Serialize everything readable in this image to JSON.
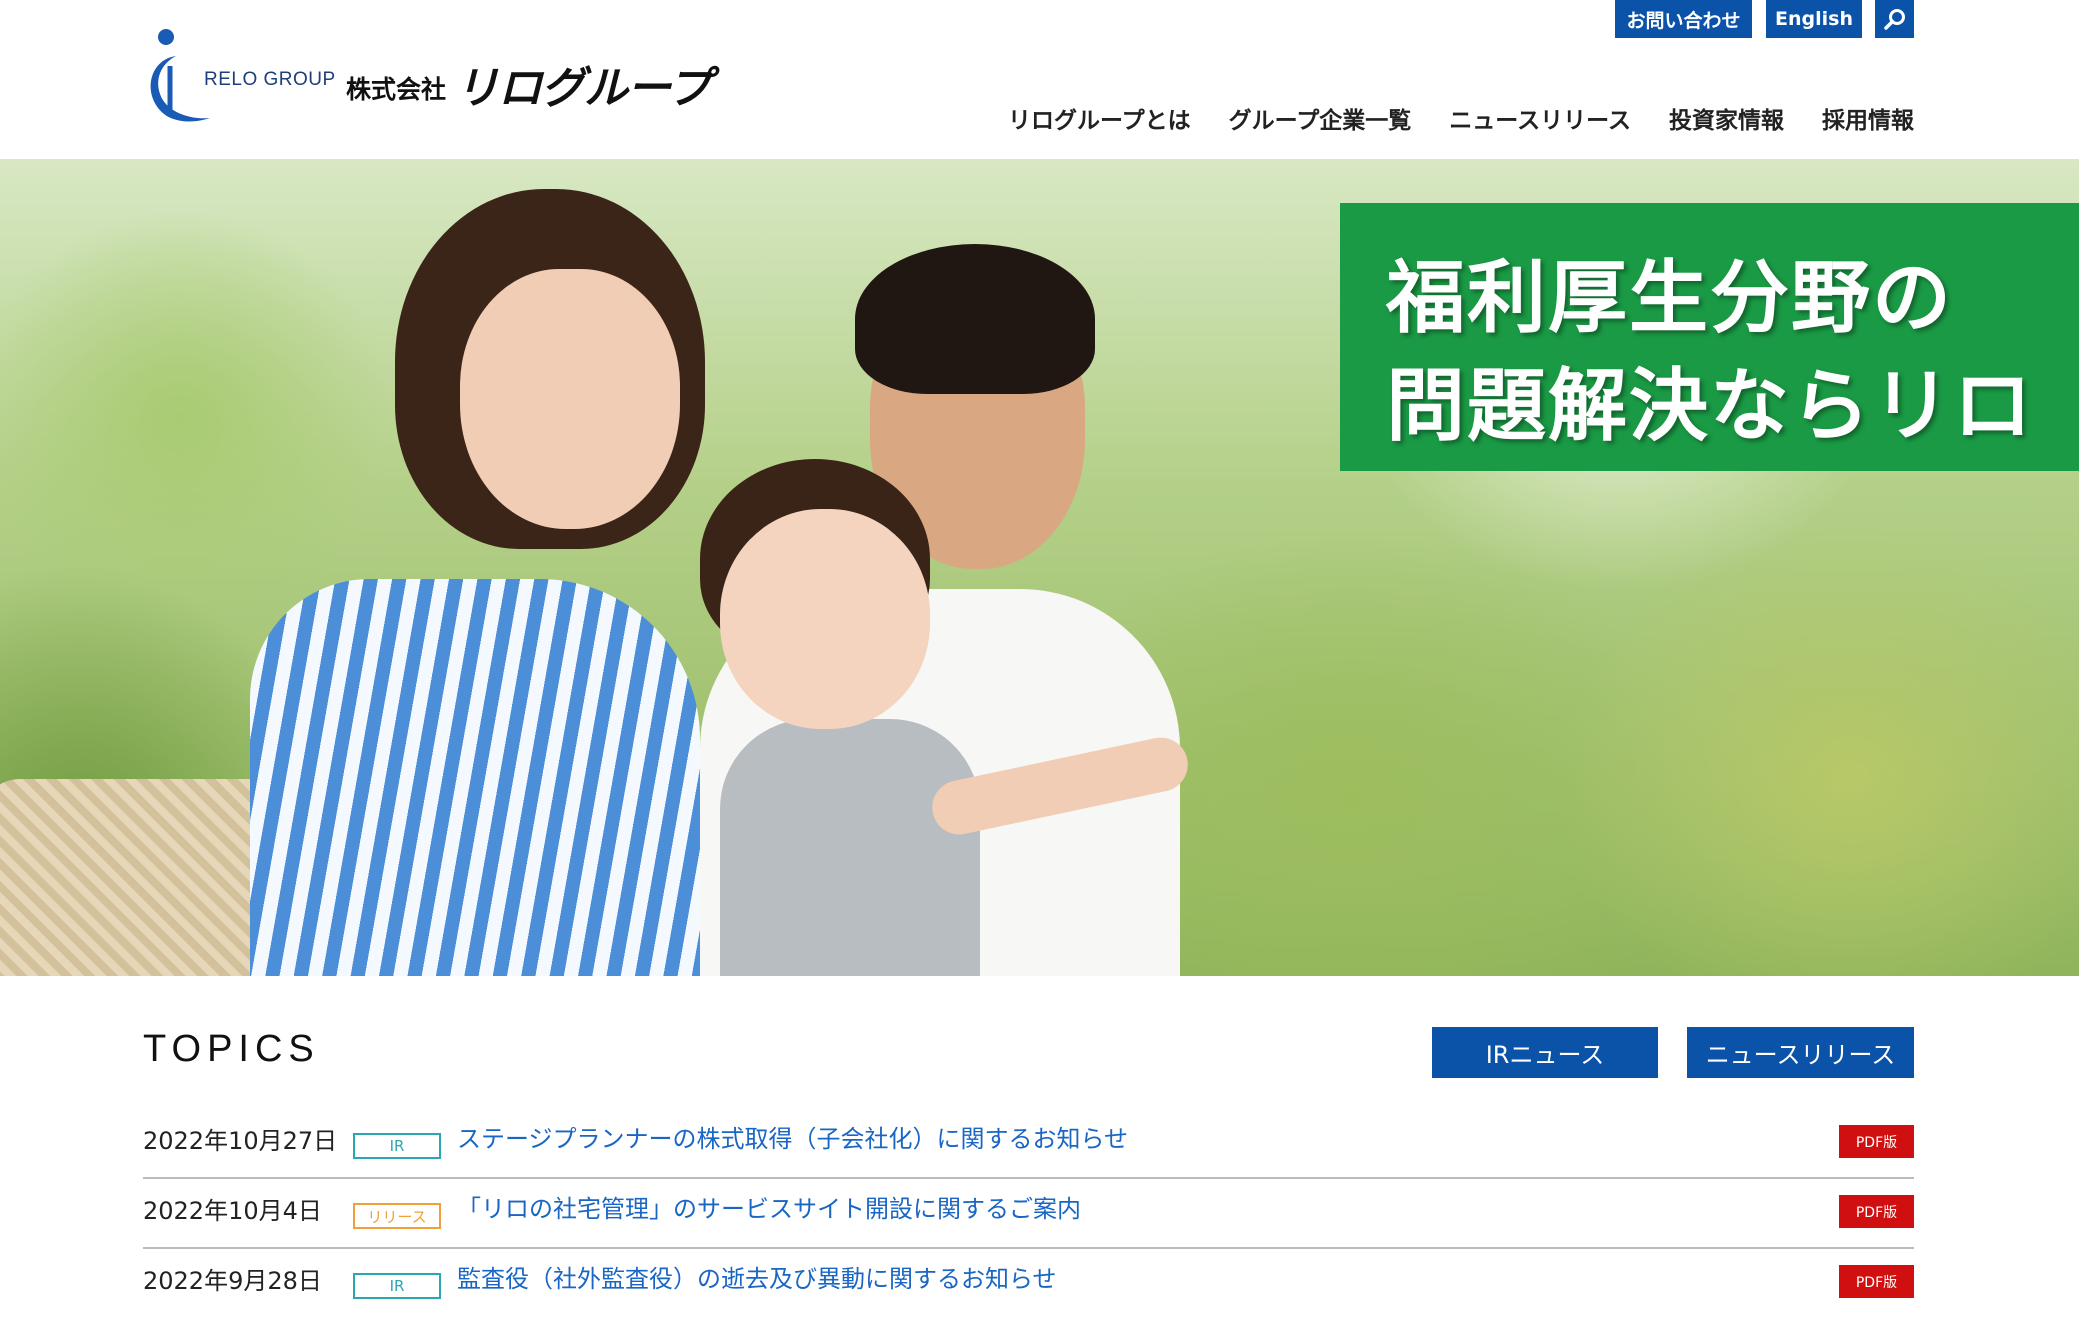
{
  "header": {
    "logo_group_text": "RELO GROUP",
    "logo_corp_prefix": "株式会社",
    "logo_corp_name": "リログループ",
    "util": {
      "contact": "お問い合わせ",
      "english": "English",
      "search_icon": "search-icon"
    },
    "nav": [
      {
        "label": "リログループとは"
      },
      {
        "label": "グループ企業一覧"
      },
      {
        "label": "ニュースリリース"
      },
      {
        "label": "投資家情報"
      },
      {
        "label": "採用情報"
      }
    ]
  },
  "hero": {
    "line1": "福利厚生分野の",
    "line2": "問題解決ならリロ",
    "banner_color": "#1a9a45"
  },
  "topics": {
    "title": "TOPICS",
    "ir_news_button": "IRニュース",
    "news_release_button": "ニュースリリース",
    "items": [
      {
        "date": "2022年10月27日",
        "tag": "IR",
        "title": "ステージプランナーの株式取得（子会社化）に関するお知らせ",
        "pdf": "PDF版"
      },
      {
        "date": "2022年10月4日",
        "tag": "リリース",
        "title": "「リロの社宅管理」のサービスサイト開設に関するご案内",
        "pdf": "PDF版"
      },
      {
        "date": "2022年9月28日",
        "tag": "IR",
        "title": "監査役（社外監査役）の逝去及び異動に関するお知らせ",
        "pdf": "PDF版"
      }
    ]
  },
  "colors": {
    "accent": "#0b53a8",
    "pdf": "#d01010",
    "tag_ir": "#2aa7b0",
    "tag_release": "#f0a03a",
    "link": "#1a66c4"
  }
}
